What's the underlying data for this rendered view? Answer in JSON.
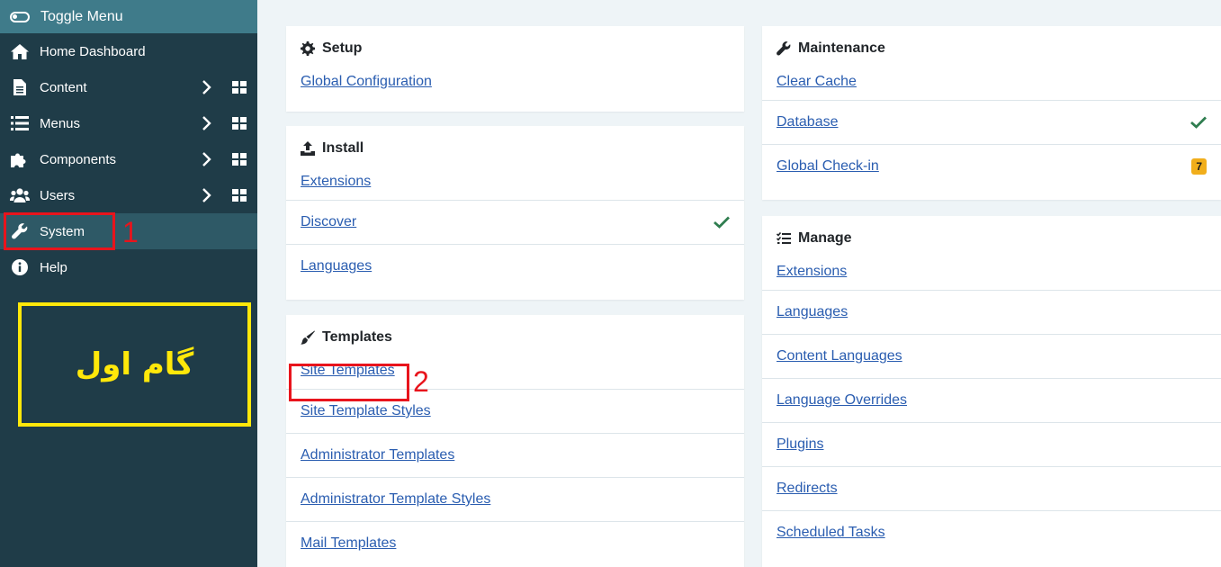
{
  "sidebar": {
    "toggle_label": "Toggle Menu",
    "items": [
      {
        "label": "Home Dashboard",
        "icon": "home-icon"
      },
      {
        "label": "Content",
        "icon": "file-icon"
      },
      {
        "label": "Menus",
        "icon": "list-icon"
      },
      {
        "label": "Components",
        "icon": "puzzle-icon"
      },
      {
        "label": "Users",
        "icon": "users-icon"
      },
      {
        "label": "System",
        "icon": "wrench-icon"
      },
      {
        "label": "Help",
        "icon": "info-icon"
      }
    ]
  },
  "annotations": {
    "step1_number": "1",
    "step2_number": "2",
    "yellow_text": "گام اول",
    "colors": {
      "red": "#e8141c",
      "yellow": "#ffe80a"
    }
  },
  "setup": {
    "title": "Setup",
    "links": [
      "Global Configuration"
    ]
  },
  "install": {
    "title": "Install",
    "links": [
      "Extensions",
      "Discover",
      "Languages"
    ]
  },
  "templates": {
    "title": "Templates",
    "links": [
      "Site Templates",
      "Site Template Styles",
      "Administrator Templates",
      "Administrator Template Styles",
      "Mail Templates"
    ]
  },
  "maintenance": {
    "title": "Maintenance",
    "links": [
      "Clear Cache",
      "Database",
      "Global Check-in"
    ],
    "checkin_badge": "7"
  },
  "manage": {
    "title": "Manage",
    "links": [
      "Extensions",
      "Languages",
      "Content Languages",
      "Language Overrides",
      "Plugins",
      "Redirects",
      "Scheduled Tasks"
    ]
  },
  "theme": {
    "sidebar_bg": "#1f3c48",
    "toggle_bg": "#3f7b8a",
    "link_color": "#2a5db0",
    "check_color": "#2f7d4f",
    "badge_color": "#f1ae1b"
  }
}
